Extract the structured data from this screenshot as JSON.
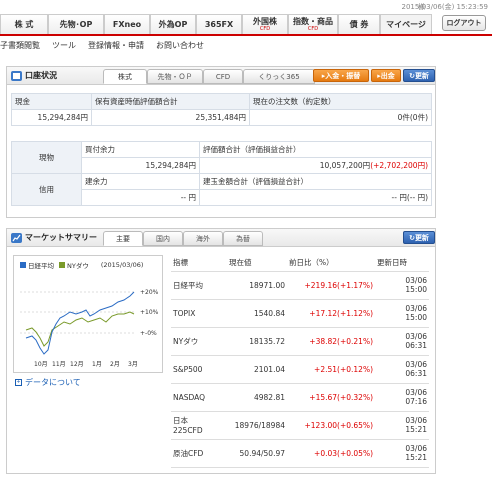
{
  "topbar": {
    "timestamp": "2015/03/06(金) 15:23:59",
    "tabs": [
      {
        "label": "株 式",
        "sub": ""
      },
      {
        "label": "先物･OP",
        "sub": ""
      },
      {
        "label": "FXneo",
        "sub": ""
      },
      {
        "label": "外為OP",
        "sub": ""
      },
      {
        "label": "365FX",
        "sub": ""
      },
      {
        "label": "外国株",
        "sub": "CFD"
      },
      {
        "label": "指数・商品",
        "sub": "CFD"
      },
      {
        "label": "債 券",
        "sub": ""
      },
      {
        "label": "マイページ",
        "sub": ""
      }
    ],
    "logout": "ログアウト"
  },
  "submenu": [
    "子書類閲覧",
    "ツール",
    "登録情報・申請",
    "お問い合わせ"
  ],
  "account": {
    "title": "口座状況",
    "tabs": [
      "株式",
      "先物・ＯＰ",
      "CFD",
      "くりっく365"
    ],
    "deposit": "入金・振替",
    "withdraw": "出金",
    "refresh": "更新",
    "head": [
      "現金",
      "保有資産時価評価額合計",
      "現在の注文数（約定数）"
    ],
    "vals": [
      "15,294,284円",
      "25,351,484円",
      "0件(0件)"
    ],
    "genbutsu": "現物",
    "shinyo": "信用",
    "kaitsuke": "買付余力",
    "kaitsuke_val": "15,294,284円",
    "hyoka": "評価額合計（評価損益合計）",
    "hyoka_val": "10,057,200円",
    "hyoka_pl": "(+2,702,200円)",
    "tateyoryoku": "建余力",
    "tate_val": "-- 円",
    "tatekin": "建玉金額合計（評価損益合計）",
    "tatekin_val": "-- 円(-- 円)"
  },
  "market": {
    "title": "マーケットサマリー",
    "tabs": [
      "主要",
      "国内",
      "海外",
      "為替"
    ],
    "refresh": "更新",
    "legend": [
      "日経平均",
      "NYダウ"
    ],
    "chart_date": "(2015/03/06)",
    "ylabels": [
      "+20%",
      "+10%",
      "+-0%"
    ],
    "xlabels": [
      "10月",
      "11月",
      "12月",
      "1月",
      "2月",
      "3月"
    ],
    "data_link": "データについて",
    "columns": [
      "指標",
      "現在値",
      "前日比（%）",
      "更新日時"
    ],
    "rows": [
      {
        "name": "日経平均",
        "name2": "",
        "value": "18971.00",
        "change": "+219.16(+1.17%)",
        "date": "03/06",
        "time": "15:00"
      },
      {
        "name": "TOPIX",
        "name2": "",
        "value": "1540.84",
        "change": "+17.12(+1.12%)",
        "date": "03/06",
        "time": "15:00"
      },
      {
        "name": "NYダウ",
        "name2": "",
        "value": "18135.72",
        "change": "+38.82(+0.21%)",
        "date": "03/06",
        "time": "06:31"
      },
      {
        "name": "S&P500",
        "name2": "",
        "value": "2101.04",
        "change": "+2.51(+0.12%)",
        "date": "03/06",
        "time": "06:31"
      },
      {
        "name": "NASDAQ",
        "name2": "",
        "value": "4982.81",
        "change": "+15.67(+0.32%)",
        "date": "03/06",
        "time": "07:16"
      },
      {
        "name": "日本",
        "name2": "225CFD",
        "value": "18976/18984",
        "change": "+123.00(+0.65%)",
        "date": "03/06",
        "time": "15:21"
      },
      {
        "name": "原油CFD",
        "name2": "",
        "value": "50.94/50.97",
        "change": "+0.03(+0.05%)",
        "date": "03/06",
        "time": "15:21"
      }
    ]
  },
  "colors": {
    "accent": "#cc0000",
    "link": "#1a5fb4",
    "change_up": "#dd0000",
    "nikkei": "#2a6bc4",
    "dow": "#7a9a2a"
  }
}
